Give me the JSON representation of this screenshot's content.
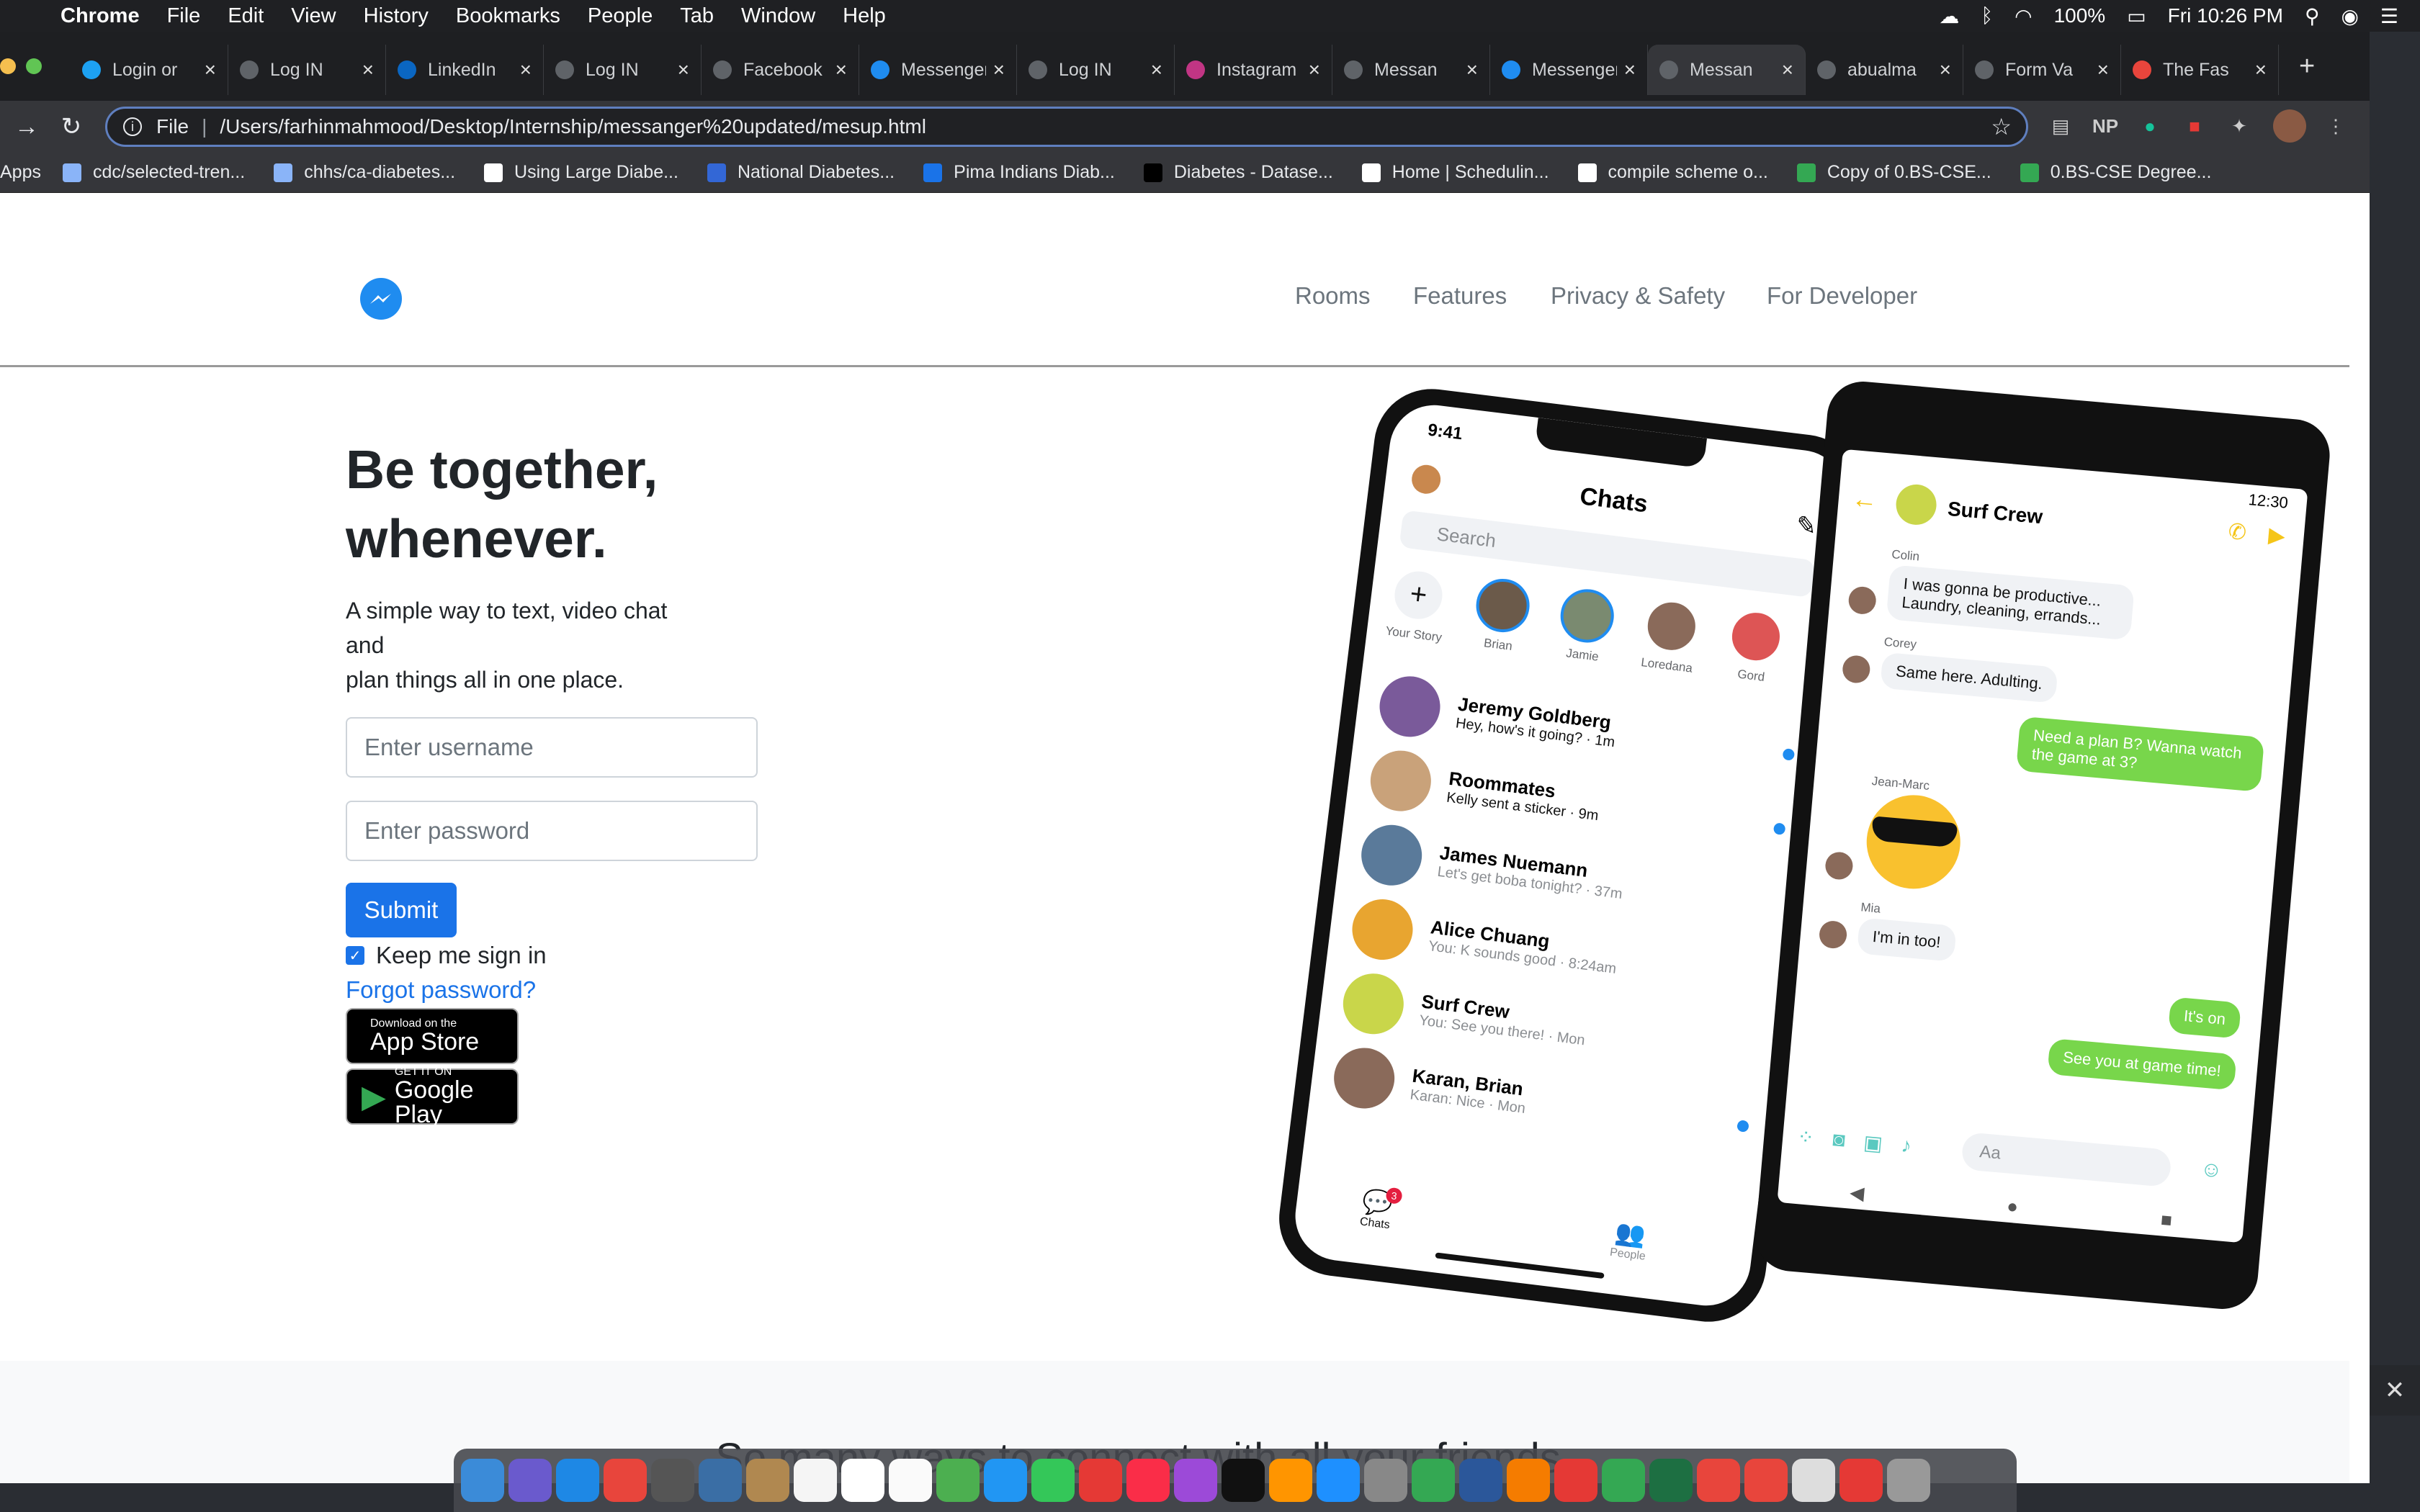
{
  "menubar": {
    "app": "Chrome",
    "items": [
      "File",
      "Edit",
      "View",
      "History",
      "Bookmarks",
      "People",
      "Tab",
      "Window",
      "Help"
    ],
    "battery": "100%",
    "clock": "Fri 10:26 PM"
  },
  "tabs": [
    {
      "title": "Login or",
      "icon": "twitter-icon",
      "color": "#1da1f2"
    },
    {
      "title": "Log IN",
      "icon": "globe-icon",
      "color": "#5f6368"
    },
    {
      "title": "LinkedIn",
      "icon": "linkedin-icon",
      "color": "#0a66c2"
    },
    {
      "title": "Log IN",
      "icon": "globe-icon",
      "color": "#5f6368"
    },
    {
      "title": "Facebook",
      "icon": "globe-icon",
      "color": "#5f6368"
    },
    {
      "title": "Messenger",
      "icon": "messenger-icon",
      "color": "#1f8cf0"
    },
    {
      "title": "Log IN",
      "icon": "globe-icon",
      "color": "#5f6368"
    },
    {
      "title": "Instagram",
      "icon": "instagram-icon",
      "color": "#c13584"
    },
    {
      "title": "Messan",
      "icon": "globe-icon",
      "color": "#5f6368"
    },
    {
      "title": "Messenger",
      "icon": "messenger-icon",
      "color": "#1f8cf0"
    },
    {
      "title": "Messan",
      "icon": "globe-icon",
      "color": "#5f6368",
      "active": true
    },
    {
      "title": "abualma",
      "icon": "globe-icon",
      "color": "#5f6368"
    },
    {
      "title": "Form Va",
      "icon": "globe-icon",
      "color": "#5f6368"
    },
    {
      "title": "The Fas",
      "icon": "flag-icon",
      "color": "#e8453c"
    }
  ],
  "address": {
    "scheme": "File",
    "url": "/Users/farhinmahmood/Desktop/Internship/messanger%20updated/mesup.html"
  },
  "bookmarks": [
    {
      "label": "Apps"
    },
    {
      "label": "cdc/selected-tren..."
    },
    {
      "label": "chhs/ca-diabetes..."
    },
    {
      "label": "Using Large Diabe..."
    },
    {
      "label": "National Diabetes..."
    },
    {
      "label": "Pima Indians Diab..."
    },
    {
      "label": "Diabetes - Datase..."
    },
    {
      "label": "Home | Schedulin..."
    },
    {
      "label": "compile scheme o..."
    },
    {
      "label": "Copy of 0.BS-CSE..."
    },
    {
      "label": "0.BS-CSE Degree..."
    }
  ],
  "nav": {
    "links": [
      "Rooms",
      "Features",
      "Privacy & Safety",
      "For Developer"
    ]
  },
  "hero": {
    "title_line1": "Be together,",
    "title_line2": "whenever.",
    "sub_line1": "A simple way to text, video chat",
    "sub_line2": "and",
    "sub_line3": "plan things all in one place."
  },
  "form": {
    "username_placeholder": "Enter username",
    "password_placeholder": "Enter password",
    "submit": "Submit",
    "keep_signed_in": "Keep me sign in",
    "forgot": "Forgot password?"
  },
  "stores": {
    "apple_small": "Download on the",
    "apple_big": "App Store",
    "google_small": "GET IT ON",
    "google_big": "Google Play"
  },
  "phone_left": {
    "time": "9:41",
    "title": "Chats",
    "search": "Search",
    "stories": [
      "Your Story",
      "Brian",
      "Jamie",
      "Loredana",
      "Gord"
    ],
    "chats": [
      {
        "name": "Jeremy Goldberg",
        "msg": "Hey, how's it going? · 1m"
      },
      {
        "name": "Roommates",
        "msg": "Kelly sent a sticker · 9m"
      },
      {
        "name": "James Nuemann",
        "msg": "Let's get boba tonight? · 37m"
      },
      {
        "name": "Alice Chuang",
        "msg": "You: K sounds good · 8:24am"
      },
      {
        "name": "Surf Crew",
        "msg": "You: See you there! · Mon"
      },
      {
        "name": "Karan, Brian",
        "msg": "Karan: Nice · Mon"
      }
    ],
    "tab_chats": "Chats",
    "tab_people": "People",
    "badge": "3"
  },
  "phone_right": {
    "time": "12:30",
    "title": "Surf Crew",
    "messages": [
      {
        "who": "Colin",
        "text": "I was gonna be productive... Laundry, cleaning, errands..."
      },
      {
        "who": "Corey",
        "text": "Same here. Adulting."
      },
      {
        "who": "me",
        "text": "Need a plan B? Wanna watch the game at 3?"
      },
      {
        "who": "Jean-Marc",
        "text": ""
      },
      {
        "who": "Mia",
        "text": "I'm in too!"
      },
      {
        "who": "me",
        "text": "It's on"
      },
      {
        "who": "me",
        "text": "See you at game time!"
      }
    ],
    "composer": "Aa"
  },
  "section2": {
    "title": "So many ways to connect with all your friends"
  }
}
